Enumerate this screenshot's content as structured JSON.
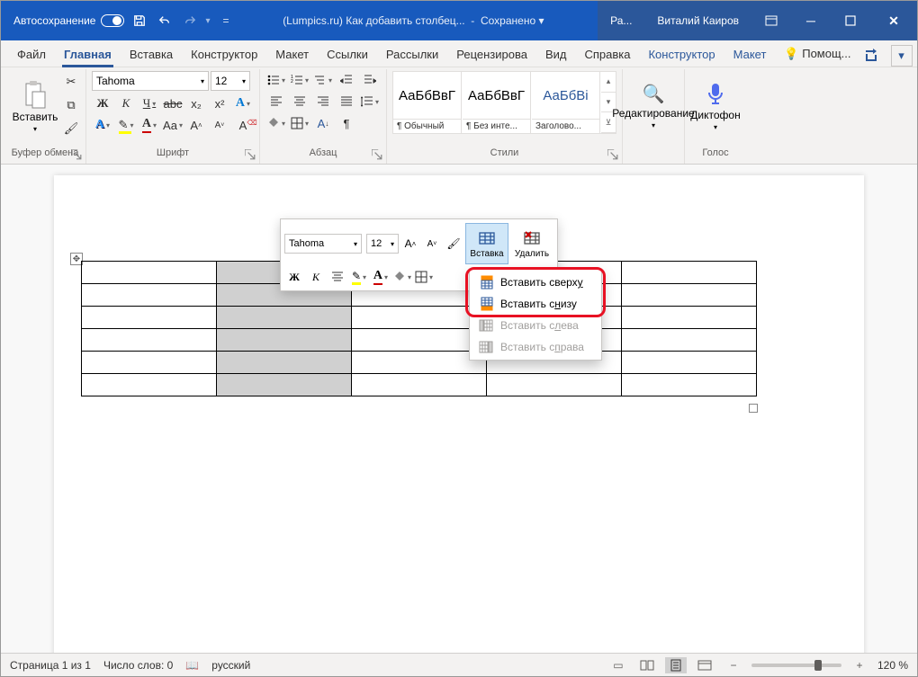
{
  "titlebar": {
    "autosave": "Автосохранение",
    "doc_title": "(Lumpics.ru) Как добавить столбец...",
    "saved_state": "Сохранено",
    "user_prefix": "Ра...",
    "user_name": "Виталий Каиров"
  },
  "tabs": {
    "file": "Файл",
    "home": "Главная",
    "insert": "Вставка",
    "design": "Конструктор",
    "layout": "Макет",
    "references": "Ссылки",
    "mailings": "Рассылки",
    "review": "Рецензирова",
    "view": "Вид",
    "help": "Справка",
    "ctx_design": "Конструктор",
    "ctx_layout": "Макет",
    "tell_me": "Помощ..."
  },
  "ribbon": {
    "clipboard": {
      "paste": "Вставить",
      "label": "Буфер обмена"
    },
    "font": {
      "name": "Tahoma",
      "size": "12",
      "label": "Шрифт",
      "bold": "Ж",
      "italic": "К",
      "underline": "Ч",
      "strike": "abc",
      "sub": "x₂",
      "sup": "x²"
    },
    "paragraph": {
      "label": "Абзац"
    },
    "styles": {
      "label": "Стили",
      "items": [
        {
          "preview": "АаБбВвГ",
          "name": "¶ Обычный"
        },
        {
          "preview": "АаБбВвГ",
          "name": "¶ Без инте..."
        },
        {
          "preview": "АаБбВі",
          "name": "Заголово..."
        }
      ]
    },
    "editing": {
      "label": "Редактирование"
    },
    "voice": {
      "button": "Диктофон",
      "label": "Голос"
    }
  },
  "mini_toolbar": {
    "font": "Tahoma",
    "size": "12",
    "bold": "Ж",
    "italic": "К",
    "insert": "Вставка",
    "delete": "Удалить"
  },
  "insert_menu": {
    "above": "Вставить сверху",
    "below": "Вставить снизу",
    "left": "Вставить слева",
    "right": "Вставить справа"
  },
  "statusbar": {
    "page": "Страница 1 из 1",
    "words": "Число слов: 0",
    "lang": "русский",
    "zoom": "120 %"
  }
}
